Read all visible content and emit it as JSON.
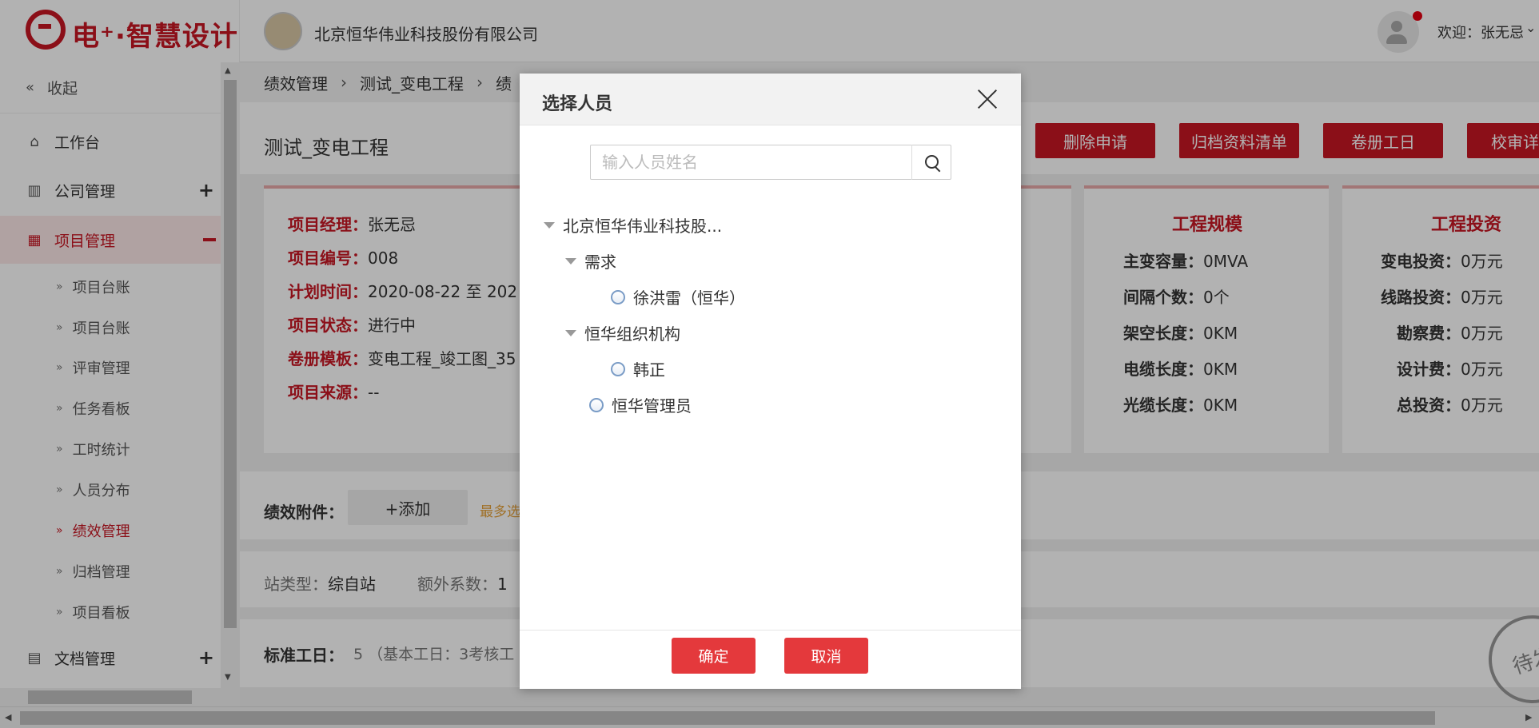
{
  "header": {
    "logo_text": "电⁺·智慧设计",
    "company": "北京恒华伟业科技股份有限公司",
    "welcome": "欢迎：张无忌"
  },
  "sidebar": {
    "collapse": "收起",
    "items": [
      {
        "label": "工作台"
      },
      {
        "label": "公司管理"
      },
      {
        "label": "项目管理"
      },
      {
        "label": "文档管理"
      }
    ],
    "sub_items": [
      "项目台账",
      "项目台账",
      "评审管理",
      "任务看板",
      "工时统计",
      "人员分布",
      "绩效管理",
      "归档管理",
      "项目看板"
    ]
  },
  "breadcrumb": [
    "绩效管理",
    "测试_变电工程",
    "绩"
  ],
  "page": {
    "title": "测试_变电工程",
    "actions": [
      "删除申请",
      "归档资料清单",
      "卷册工日",
      "校审详"
    ]
  },
  "project_info": [
    {
      "key": "项目经理：",
      "value": "张无忌"
    },
    {
      "key": "项目编号：",
      "value": "008"
    },
    {
      "key": "计划时间：",
      "value": "2020-08-22 至 202"
    },
    {
      "key": "项目状态：",
      "value": "进行中"
    },
    {
      "key": "卷册模板：",
      "value": "变电工程_竣工图_35"
    },
    {
      "key": "项目来源：",
      "value": "--"
    }
  ],
  "scale": {
    "title": "工程规模",
    "rows": [
      {
        "key": "主变容量：",
        "value": "0MVA"
      },
      {
        "key": "间隔个数：",
        "value": "0个"
      },
      {
        "key": "架空长度：",
        "value": "0KM"
      },
      {
        "key": "电缆长度：",
        "value": "0KM"
      },
      {
        "key": "光缆长度：",
        "value": "0KM"
      }
    ]
  },
  "investment": {
    "title": "工程投资",
    "rows": [
      {
        "key": "变电投资：",
        "value": "0万元"
      },
      {
        "key": "线路投资：",
        "value": "0万元"
      },
      {
        "key": "勘察费：",
        "value": "0万元"
      },
      {
        "key": "设计费：",
        "value": "0万元"
      },
      {
        "key": "总投资：",
        "value": "0万元"
      }
    ]
  },
  "attach": {
    "label": "绩效附件：",
    "add": "+添加",
    "hint": "最多选"
  },
  "station": {
    "type_label": "站类型：",
    "type_value": "综自站",
    "coef_label": "额外系数：",
    "coef_value": "1"
  },
  "std": {
    "label": "标准工日：",
    "value": "5 （基本工日：3考核工"
  },
  "stamp": "待发",
  "modal": {
    "title": "选择人员",
    "search_placeholder": "输入人员姓名",
    "tree": {
      "root": "北京恒华伟业科技股...",
      "g1": "需求",
      "g1_p1": "徐洪雷（恒华）",
      "g2": "恒华组织机构",
      "g2_p1": "韩正",
      "p_admin": "恒华管理员"
    },
    "ok": "确定",
    "cancel": "取消"
  },
  "colors": {
    "brand": "#c81623",
    "button": "#e4393c"
  }
}
